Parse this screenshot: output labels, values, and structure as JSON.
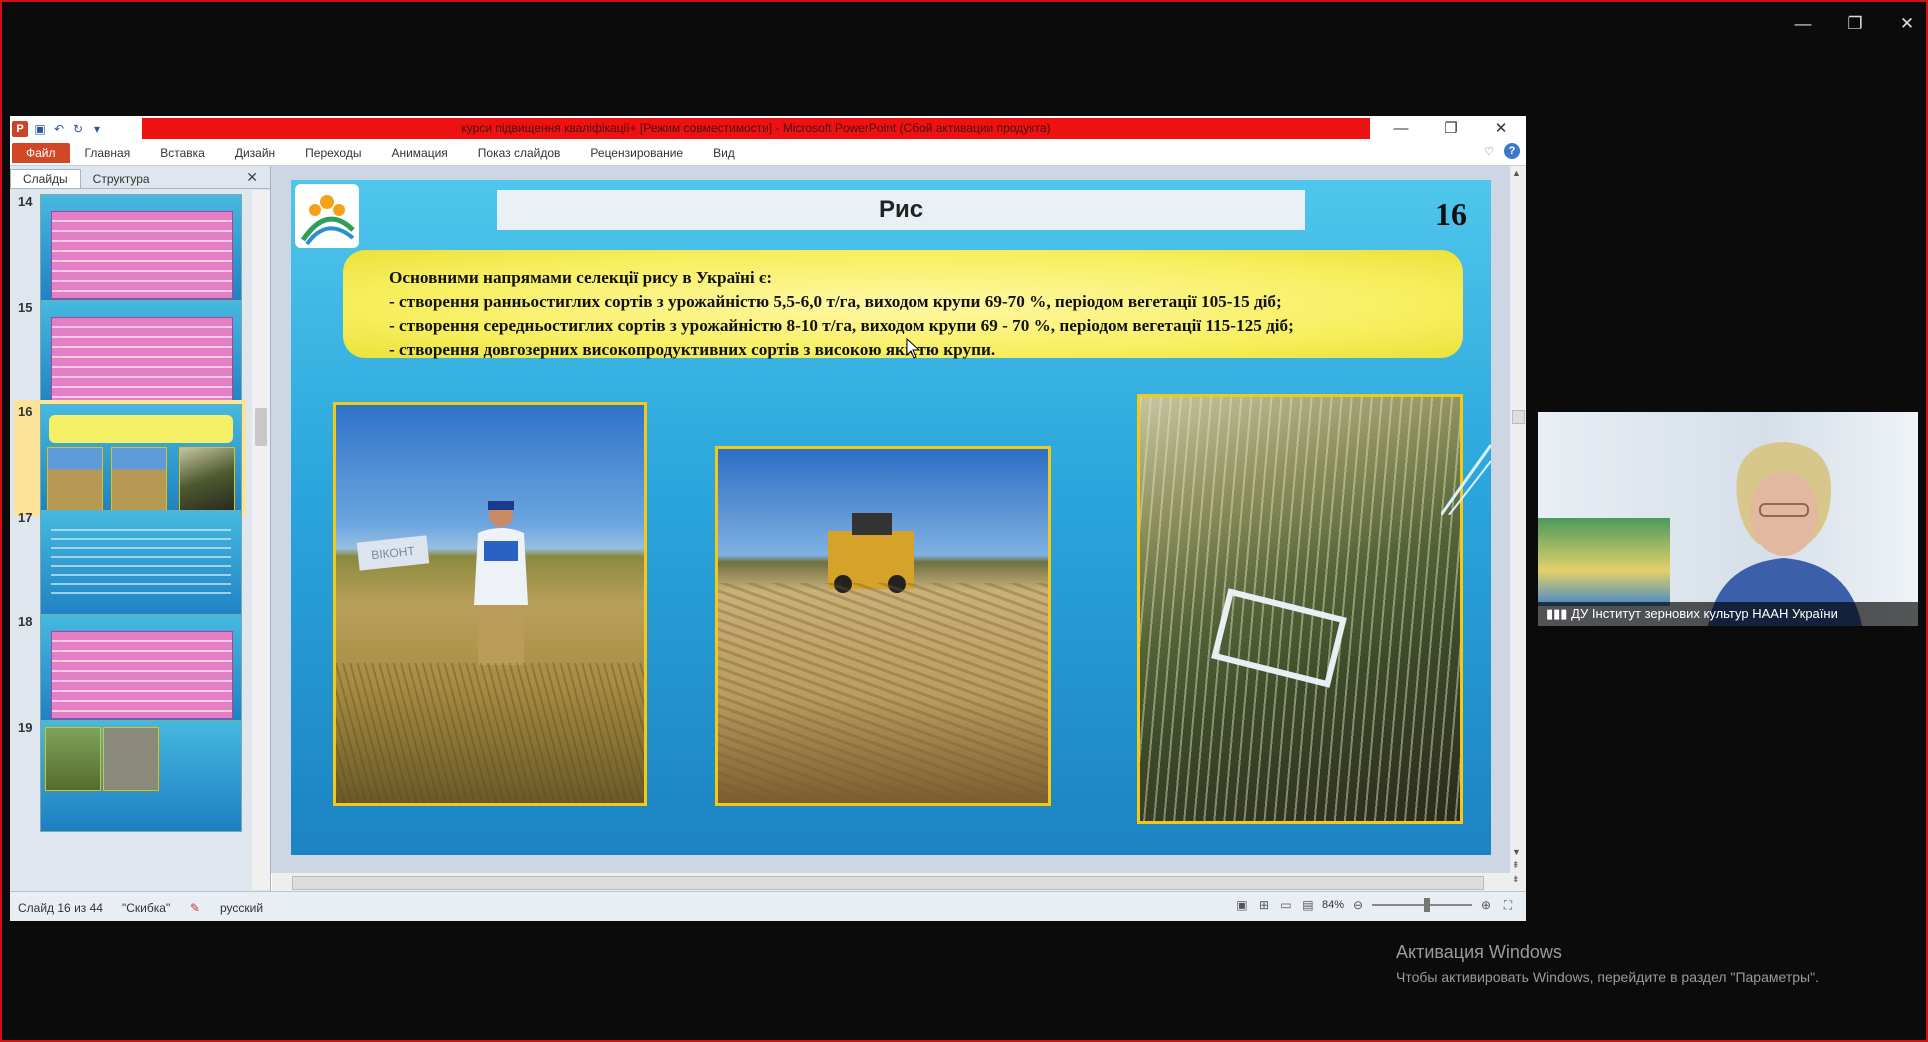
{
  "app": {
    "title": "курси підвищення кваліфікації+ [Режим совместимости]  -  Microsoft PowerPoint (Сбой активации продукта)",
    "file_tab": "Файл",
    "tabs": [
      "Главная",
      "Вставка",
      "Дизайн",
      "Переходы",
      "Анимация",
      "Показ слайдов",
      "Рецензирование",
      "Вид"
    ],
    "icon_names": [
      "powerpoint-logo-icon",
      "save-icon",
      "undo-icon",
      "redo-icon",
      "customize-qat-icon",
      "minimize-icon",
      "restore-icon",
      "close-icon",
      "help-icon"
    ]
  },
  "left_pane": {
    "tabs": [
      "Слайды",
      "Структура"
    ],
    "thumbnails": [
      {
        "num": "14",
        "type": "table"
      },
      {
        "num": "15",
        "type": "table"
      },
      {
        "num": "16",
        "type": "photos",
        "selected": true
      },
      {
        "num": "17",
        "type": "text"
      },
      {
        "num": "18",
        "type": "table"
      },
      {
        "num": "19",
        "type": "photos"
      }
    ]
  },
  "slide": {
    "title": "Рис",
    "number": "16",
    "lines": [
      "Основними напрямами селекції рису в Україні є:",
      "- створення ранньостиглих  сортів з урожайністю 5,5-6,0 т/га, виходом крупи  69-70 %, періодом вегетації 105-15 діб;",
      " - створення середньостиглих сортів з урожайністю 8-10 т/га, виходом крупи  69 - 70 %, періодом вегетації 115-125 діб;",
      "- створення довгозерних високопродуктивних сортів з високою якістю крупи."
    ],
    "photo_sign": "ВІКОНТ",
    "colors": {
      "background": "#2ba6dc",
      "yellow": "#f7ef5f",
      "photo_border": "#f4c916"
    }
  },
  "status": {
    "slide_info": "Слайд 16 из 44",
    "theme": "\"Скибка\"",
    "language": "русский",
    "zoom": "84%"
  },
  "camera": {
    "label": "ДУ Інститут зернових культур НААН України"
  },
  "activation": {
    "title": "Активация Windows",
    "subtitle": "Чтобы активировать Windows, перейдите в раздел \"Параметры\"."
  }
}
